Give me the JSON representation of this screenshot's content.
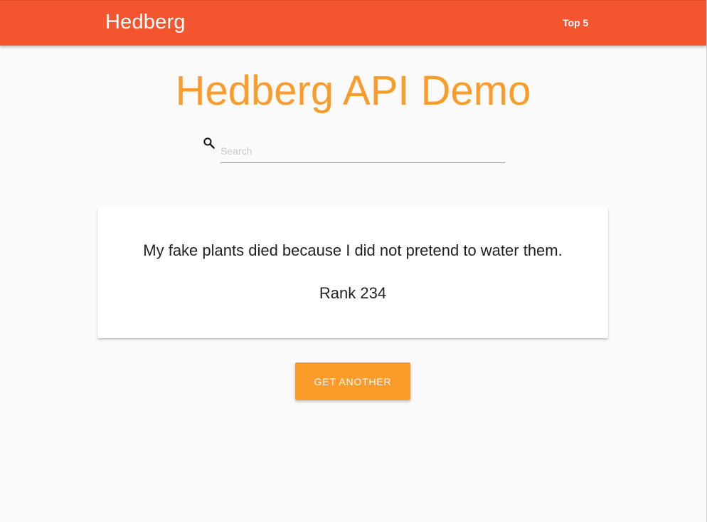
{
  "navbar": {
    "brand": "Hedberg",
    "links": [
      {
        "label": "Top 5"
      }
    ],
    "color": "#f3552f"
  },
  "main": {
    "title": "Hedberg API Demo",
    "title_color": "#fb9b2a",
    "search": {
      "icon": "search-icon",
      "placeholder": "Search",
      "value": ""
    },
    "quote_card": {
      "text": "My fake plants died because I did not pretend to water them.",
      "rank": "Rank 234"
    },
    "get_another_button": {
      "label": "GET ANOTHER",
      "color": "#fb9b2a"
    }
  }
}
